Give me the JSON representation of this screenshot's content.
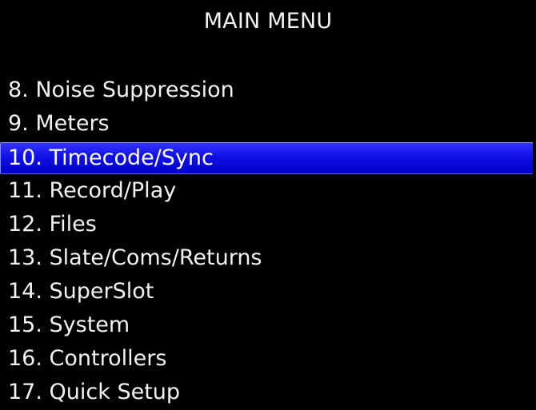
{
  "menu": {
    "title": "MAIN MENU",
    "items": [
      {
        "label": "8. Noise Suppression",
        "selected": false
      },
      {
        "label": "9. Meters",
        "selected": false
      },
      {
        "label": "10. Timecode/Sync",
        "selected": true
      },
      {
        "label": "11. Record/Play",
        "selected": false
      },
      {
        "label": "12. Files",
        "selected": false
      },
      {
        "label": "13. Slate/Coms/Returns",
        "selected": false
      },
      {
        "label": "14. SuperSlot",
        "selected": false
      },
      {
        "label": "15. System",
        "selected": false
      },
      {
        "label": "16. Controllers",
        "selected": false
      },
      {
        "label": "17. Quick Setup",
        "selected": false
      }
    ]
  },
  "colors": {
    "background": "#000000",
    "text": "#f2f2f2",
    "highlight": "#1010e6"
  }
}
